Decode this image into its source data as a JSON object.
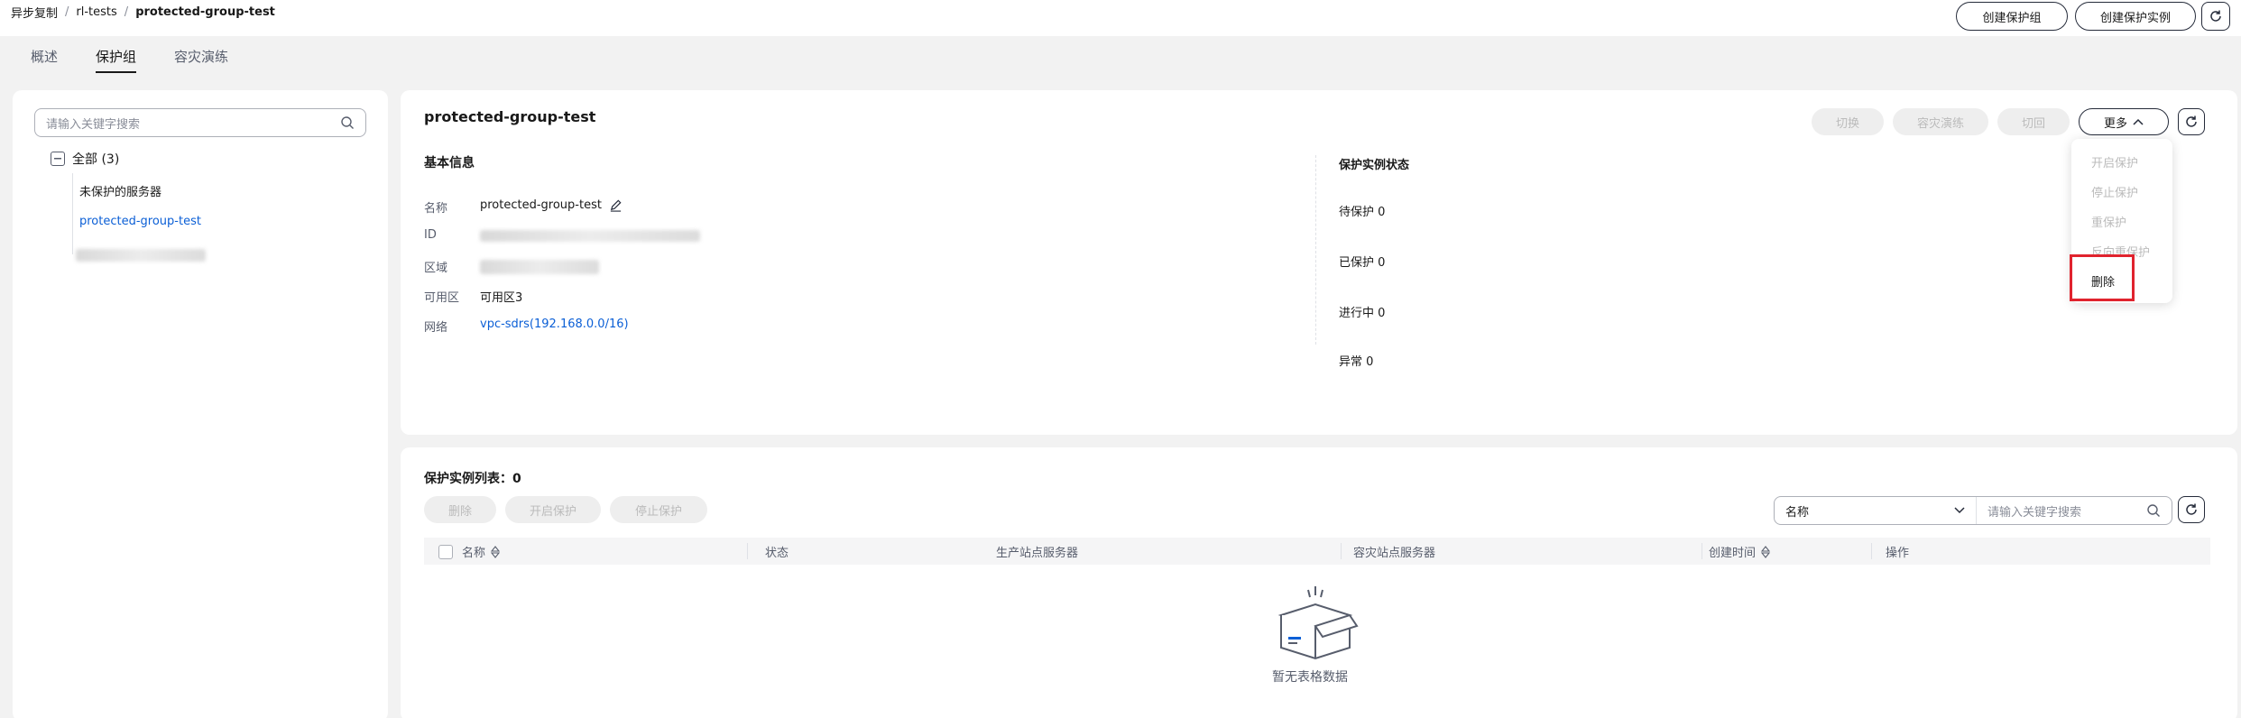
{
  "breadcrumb": {
    "root": "异步复制",
    "mid": "rl-tests",
    "current": "protected-group-test"
  },
  "header_buttons": {
    "create_group": "创建保护组",
    "create_instance": "创建保护实例"
  },
  "tabs": [
    {
      "label": "概述"
    },
    {
      "label": "保护组"
    },
    {
      "label": "容灾演练"
    }
  ],
  "left": {
    "search_placeholder": "请输入关键字搜索",
    "tree_root": "全部 (3)",
    "items": [
      "未保护的服务器",
      "protected-group-test"
    ]
  },
  "group": {
    "title": "protected-group-test",
    "actions": {
      "switch": "切换",
      "drill": "容灾演练",
      "failback": "切回",
      "more": "更多"
    },
    "basic_title": "基本信息",
    "fields": {
      "name_label": "名称",
      "name_value": "protected-group-test",
      "id_label": "ID",
      "region_label": "区域",
      "az_label": "可用区",
      "az_value": "可用区3",
      "network_label": "网络",
      "network_value": "vpc-sdrs(192.168.0.0/16)"
    },
    "status_title": "保护实例状态",
    "status": [
      "待保护 0",
      "已保护 0",
      "进行中 0",
      "异常 0"
    ]
  },
  "more_menu": [
    "开启保护",
    "停止保护",
    "重保护",
    "反向重保护",
    "删除"
  ],
  "instances": {
    "title": "保护实例列表：0",
    "buttons": {
      "delete": "删除",
      "start": "开启保护",
      "stop": "停止保护"
    },
    "filter": {
      "field": "名称",
      "placeholder": "请输入关键字搜索"
    },
    "columns": [
      "名称",
      "状态",
      "生产站点服务器",
      "容灾站点服务器",
      "创建时间",
      "操作"
    ],
    "empty": "暂无表格数据"
  },
  "colors": {
    "accent": "#0b5fd6",
    "highlight": "#e0232e"
  }
}
